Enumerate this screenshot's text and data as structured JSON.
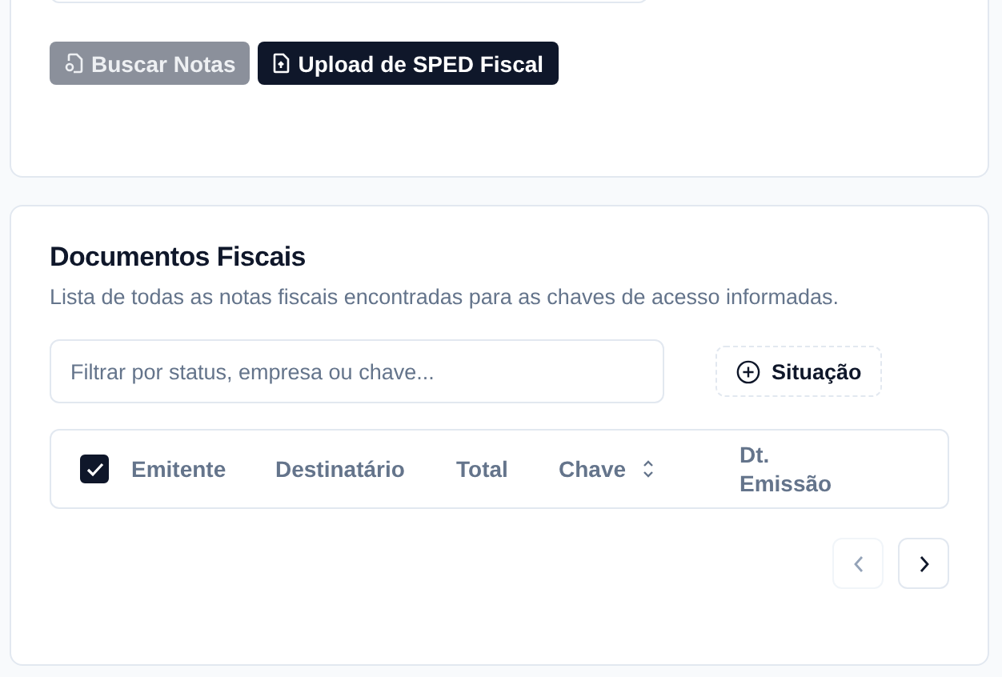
{
  "top_card": {
    "buttons": [
      {
        "label": "Buscar Notas",
        "kind": "search",
        "disabled": true
      },
      {
        "label": "Upload de SPED Fiscal",
        "kind": "upload",
        "disabled": false
      }
    ]
  },
  "documents": {
    "title": "Documentos Fiscais",
    "description": "Lista de todas as notas fiscais encontradas para as chaves de acesso informadas.",
    "filter": {
      "placeholder": "Filtrar por status, empresa ou chave..."
    },
    "status_filter": {
      "label": "Situação"
    },
    "table": {
      "select_all": {
        "checked": true
      },
      "columns": [
        {
          "label": "Emitente",
          "sortable": false
        },
        {
          "label": "Destinatário",
          "sortable": false
        },
        {
          "label": "Total",
          "sortable": false
        },
        {
          "label": "Chave",
          "sortable": true
        },
        {
          "label": "Dt. Emissão",
          "sortable": false
        }
      ]
    },
    "pagination": {
      "previous": {
        "disabled": true
      },
      "next": {
        "disabled": false
      }
    }
  }
}
